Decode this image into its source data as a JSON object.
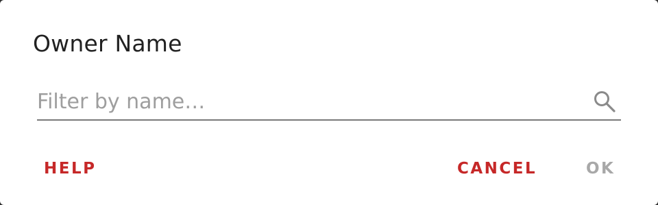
{
  "dialog": {
    "title": "Owner Name",
    "search": {
      "placeholder": "Filter by name…",
      "value": "",
      "icon": "search-icon"
    },
    "buttons": {
      "help": "HELP",
      "cancel": "CANCEL",
      "ok": "OK"
    },
    "colors": {
      "accent": "#c62828",
      "disabled": "#a8a8a8",
      "title": "#212121",
      "placeholder": "#9e9e9e"
    }
  }
}
